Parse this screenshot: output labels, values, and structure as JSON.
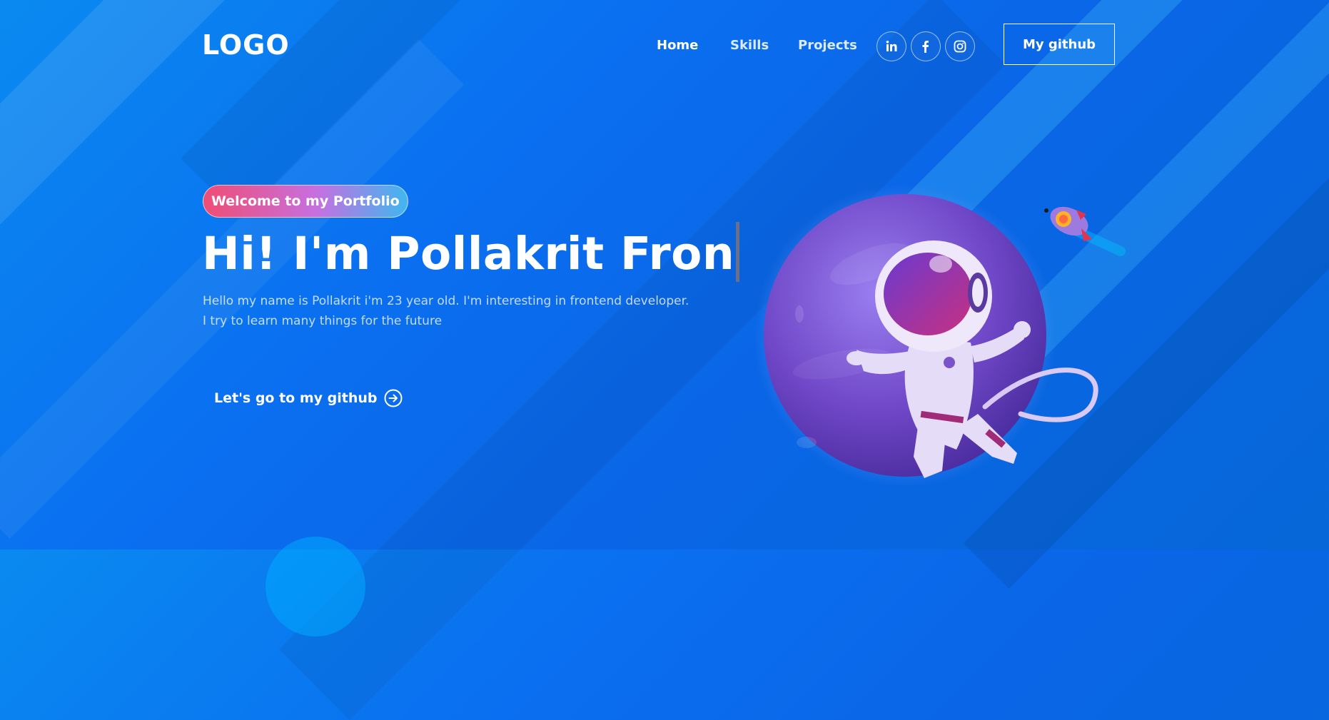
{
  "nav": {
    "logo": "LOGO",
    "links": [
      "Home",
      "Skills",
      "Projects"
    ],
    "socials": [
      "linkedin-icon",
      "facebook-icon",
      "instagram-icon"
    ],
    "github_button": "My github"
  },
  "hero": {
    "tagline": "Welcome to my Portfolio",
    "headline": "Hi! I'm Pollakrit Fron",
    "description_line1": "Hello my name is Pollakrit i'm 23 year old. I'm interesting in frontend developer.",
    "description_line2": "I try to learn many things for the future",
    "cta": "Let's go to my github"
  },
  "colors": {
    "background": "#0a6ff0",
    "tagline_gradient": [
      "#ef4d74",
      "#c76fe0",
      "#3fb7f0"
    ],
    "planet": "#6f47c7"
  }
}
